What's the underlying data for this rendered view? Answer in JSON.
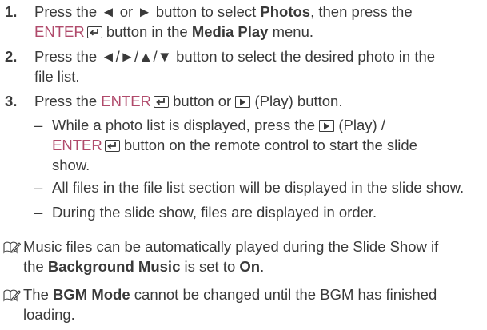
{
  "steps": [
    {
      "number": "1.",
      "line1_a": "Press the ◄ or ► button to select ",
      "line1_b": "Photos",
      "line1_c": ", then press the",
      "line2_a": "ENTER",
      "line2_b": " button in the ",
      "line2_c": "Media Play",
      "line2_d": " menu."
    },
    {
      "number": "2.",
      "line1": "Press the ◄/►/▲/▼ button to select the desired photo in the",
      "line2": "file list."
    },
    {
      "number": "3.",
      "line1_a": "Press the ",
      "line1_b": "ENTER",
      "line1_c": " button or ",
      "line1_d": " (Play) button.",
      "subs": [
        {
          "dash": "–",
          "l1_a": "While a photo list is displayed, press the ",
          "l1_b": " (Play) /",
          "l2_a": "ENTER",
          "l2_b": " button on the remote control to start the slide",
          "l3": "show."
        },
        {
          "dash": "–",
          "l1": "All files in the file list section will be displayed in the slide show."
        },
        {
          "dash": "–",
          "l1": "During the slide show, files are displayed in order."
        }
      ]
    }
  ],
  "notes": [
    {
      "icon": "note-pencil-icon",
      "l1": "Music files can be automatically played during the Slide Show if",
      "l2_a": "the ",
      "l2_b": "Background Music",
      "l2_c": " is set to ",
      "l2_d": "On",
      "l2_e": "."
    },
    {
      "icon": "note-pencil-icon",
      "l1_a": "The ",
      "l1_b": "BGM Mode",
      "l1_c": " cannot be changed until the BGM has finished",
      "l2": "loading."
    }
  ],
  "colors": {
    "text": "#3a3a3a",
    "accent": "#b04a6b"
  }
}
